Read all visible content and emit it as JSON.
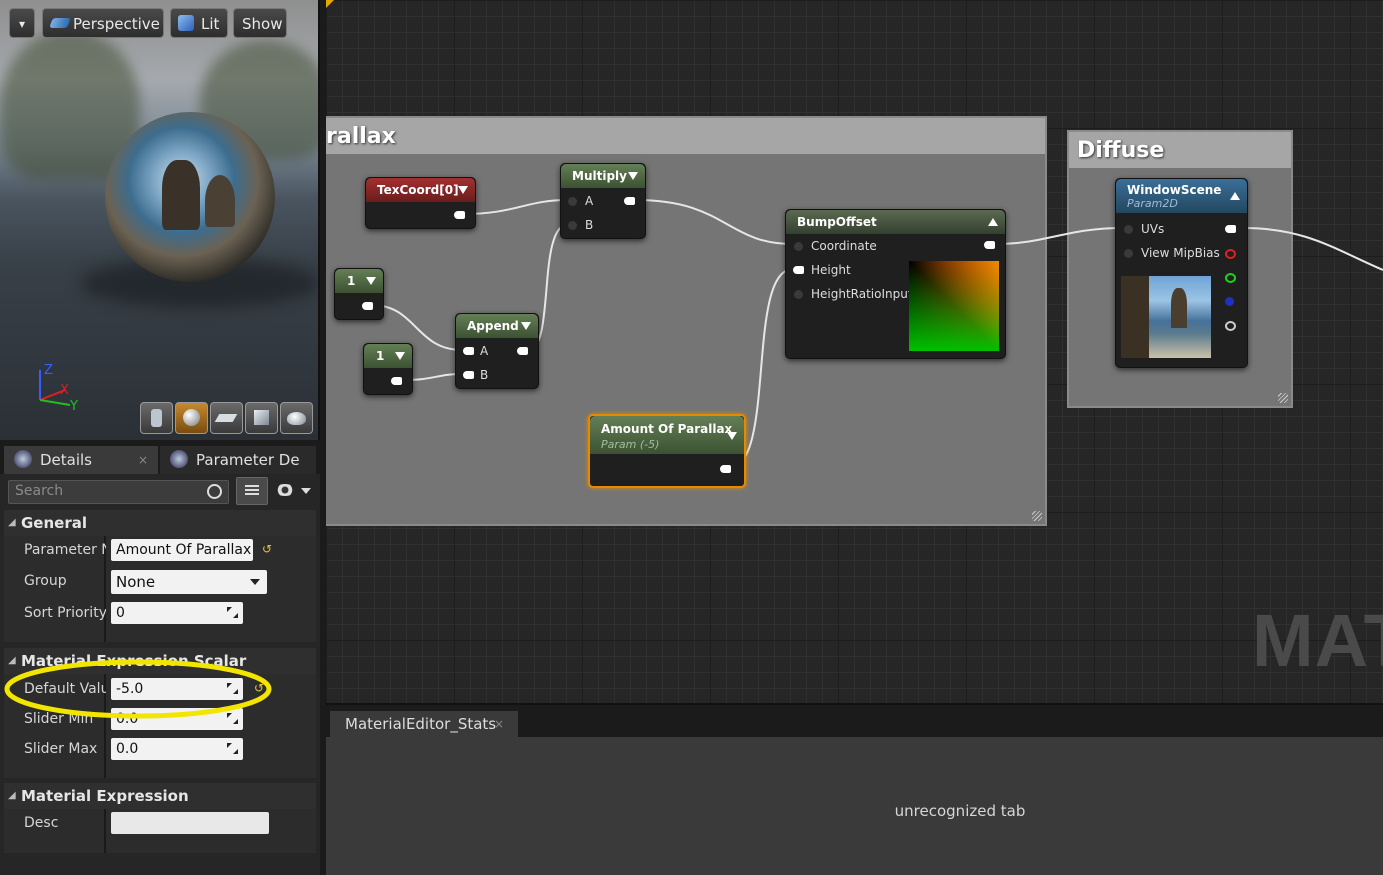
{
  "viewport": {
    "menu_label": "▾",
    "perspective_label": "Perspective",
    "lit_label": "Lit",
    "show_label": "Show",
    "axis_z": "Z",
    "axis_x": "X",
    "axis_y": "Y",
    "preview_tools": [
      "cylinder-icon",
      "sphere-icon",
      "plane-icon",
      "cube-icon",
      "teapot-icon"
    ]
  },
  "details": {
    "tabs": [
      {
        "label": "Details",
        "close": "×"
      },
      {
        "label": "Parameter De"
      }
    ],
    "search_placeholder": "Search",
    "sections": {
      "general": {
        "title": "General",
        "parameter_name_label": "Parameter N",
        "parameter_name_value": "Amount Of Parallax",
        "group_label": "Group",
        "group_value": "None",
        "sort_priority_label": "Sort Priority",
        "sort_priority_value": "0"
      },
      "scalar": {
        "title": "Material Expression Scalar Parameter",
        "default_value_label": "Default Valu",
        "default_value": "-5.0",
        "slider_min_label": "Slider Min",
        "slider_min_value": "0.0",
        "slider_max_label": "Slider Max",
        "slider_max_value": "0.0"
      },
      "expression": {
        "title": "Material Expression",
        "desc_label": "Desc",
        "desc_value": ""
      }
    },
    "highlight_color": "#f2e600"
  },
  "graph": {
    "comment_parallax": "rallax",
    "comment_diffuse": "Diffuse",
    "watermark": "MAT",
    "nodes": {
      "texcoord": {
        "title": "TexCoord[0]"
      },
      "multiply": {
        "title": "Multiply",
        "pin_a": "A",
        "pin_b": "B"
      },
      "const1a": {
        "title": "1"
      },
      "const1b": {
        "title": "1"
      },
      "append": {
        "title": "Append",
        "pin_a": "A",
        "pin_b": "B"
      },
      "bumpoffset": {
        "title": "BumpOffset",
        "pin_coordinate": "Coordinate",
        "pin_height": "Height",
        "pin_ratio": "HeightRatioInput"
      },
      "amount": {
        "title": "Amount Of Parallax",
        "subtitle": "Param (-5)"
      },
      "windowscene": {
        "title": "WindowScene",
        "subtitle": "Param2D",
        "pin_uvs": "UVs",
        "pin_mipbias": "View MipBias"
      }
    },
    "colors": {
      "selected_outline": "#e68a00",
      "pin_red": "#e02020",
      "pin_green": "#20d020",
      "pin_blue": "#2030c0"
    }
  },
  "stats": {
    "tab_label": "MaterialEditor_Stats",
    "tab_close": "×",
    "body_text": "unrecognized tab"
  }
}
